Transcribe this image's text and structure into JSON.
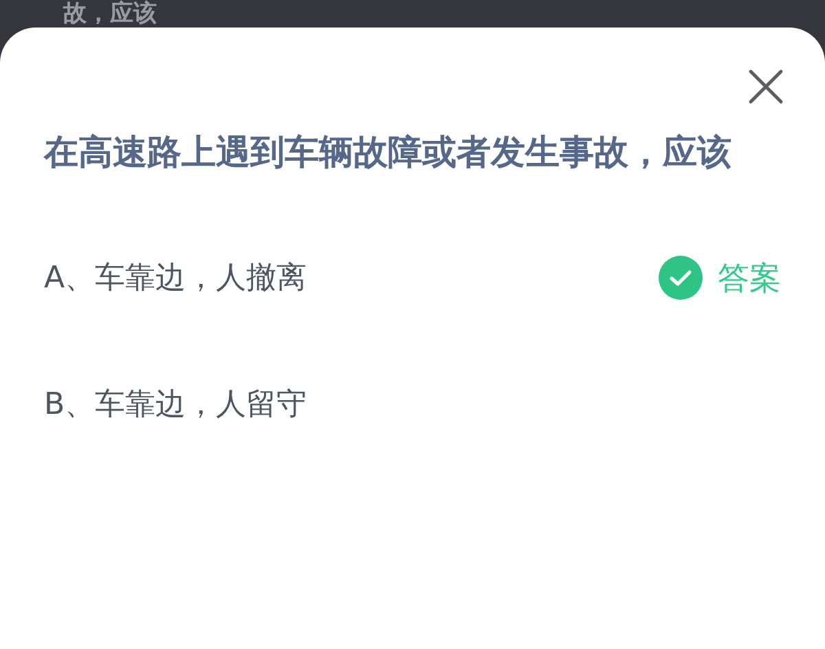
{
  "background_text": "故，应该",
  "question": "在高速路上遇到车辆故障或者发生事故，应该",
  "options": [
    {
      "label": "A、车靠边，人撤离",
      "correct": true
    },
    {
      "label": "B、车靠边，人留守",
      "correct": false
    }
  ],
  "answer_label": "答案"
}
